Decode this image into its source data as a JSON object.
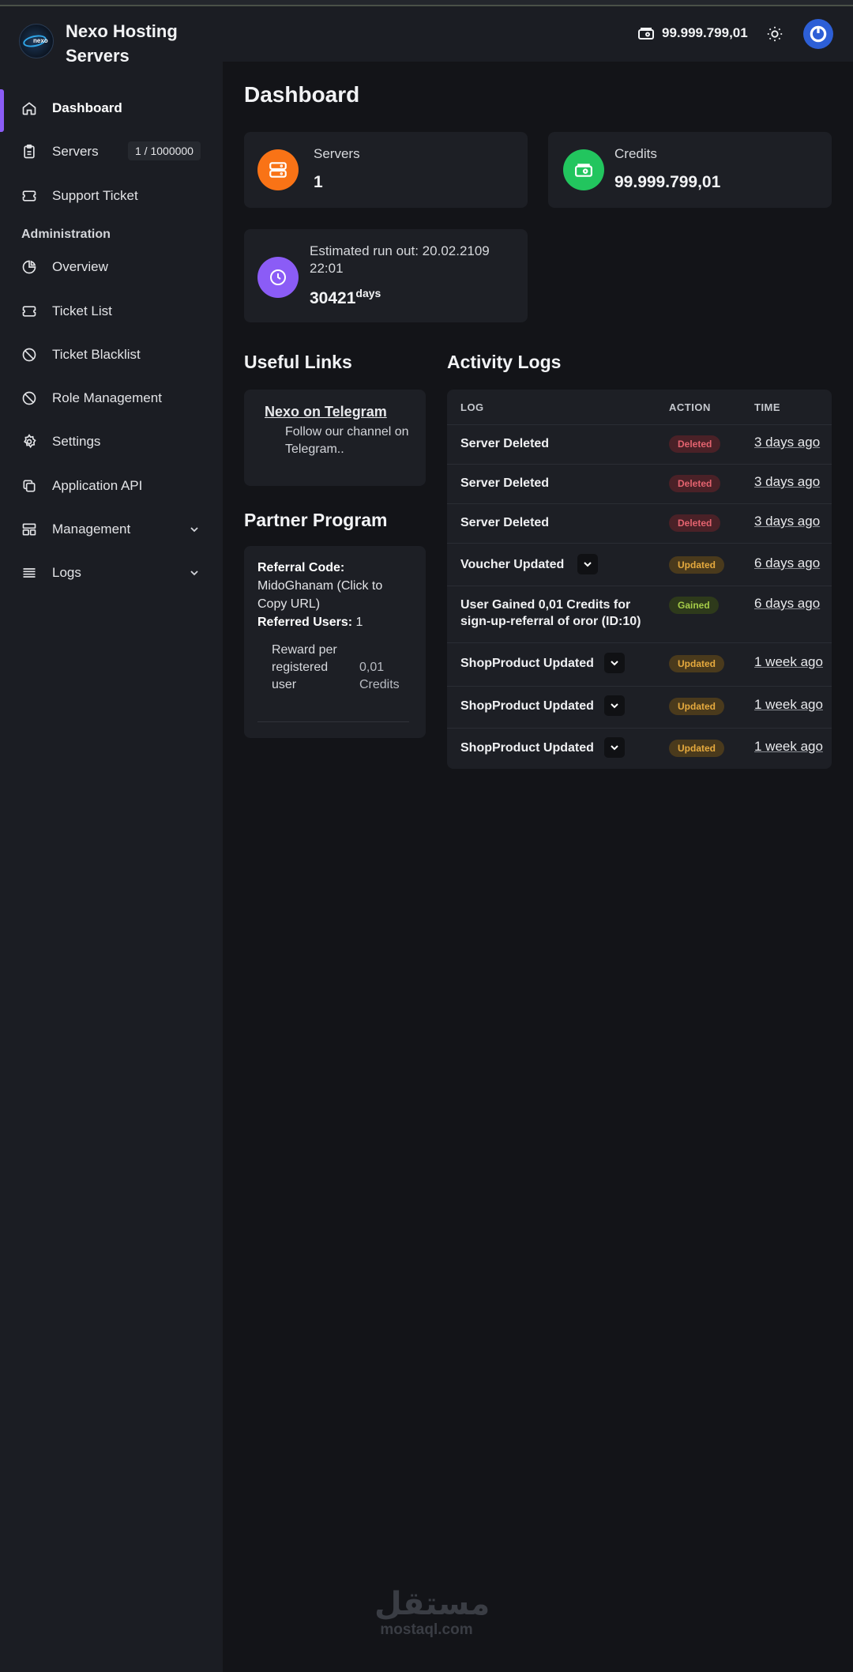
{
  "brand": {
    "name": "Nexo Hosting Servers",
    "logo_text": "nexo"
  },
  "header": {
    "credits": "99.999.799,01"
  },
  "sidebar": {
    "items": [
      {
        "label": "Dashboard",
        "icon": "home-icon"
      },
      {
        "label": "Servers",
        "badge": "1 / 1000000",
        "icon": "clipboard-icon"
      },
      {
        "label": "Support Ticket",
        "icon": "ticket-icon"
      },
      {
        "label": "Overview",
        "icon": "pie-chart-icon"
      },
      {
        "label": "Ticket List",
        "icon": "ticket-icon"
      },
      {
        "label": "Ticket Blacklist",
        "icon": "ban-icon"
      },
      {
        "label": "Role Management",
        "icon": "ban-icon"
      },
      {
        "label": "Settings",
        "icon": "gear-icon"
      },
      {
        "label": "Application API",
        "icon": "copy-icon"
      },
      {
        "label": "Management",
        "icon": "layout-icon"
      },
      {
        "label": "Logs",
        "icon": "list-icon"
      }
    ],
    "section_admin": "Administration"
  },
  "page": {
    "title": "Dashboard"
  },
  "stats": {
    "servers_label": "Servers",
    "servers_value": "1",
    "credits_label": "Credits",
    "credits_value": "99.999.799,01",
    "runout_label": "Estimated run out: 20.02.2109 22:01",
    "runout_value": "30421",
    "runout_unit": "days",
    "colors": {
      "servers": "#f97316",
      "credits": "#22c55e",
      "runout": "#8b5cf6"
    }
  },
  "useful_links": {
    "title": "Useful Links",
    "link_title": "Nexo on Telegram",
    "link_desc": "Follow our channel on Telegram.."
  },
  "partner": {
    "title": "Partner Program",
    "referral_code_label": "Referral Code:",
    "referral_code_value": "MidoGhanam (Click to Copy URL)",
    "referred_users_label": "Referred Users:",
    "referred_users_value": "1",
    "reward_label": "Reward per registered user",
    "reward_value": "0,01 Credits"
  },
  "activity": {
    "title": "Activity Logs",
    "columns": [
      "LOG",
      "ACTION",
      "TIME"
    ],
    "rows": [
      {
        "log": "Server Deleted",
        "action": "Deleted",
        "time": "3 days ago"
      },
      {
        "log": "Server Deleted",
        "action": "Deleted",
        "time": "3 days ago"
      },
      {
        "log": "Server Deleted",
        "action": "Deleted",
        "time": "3 days ago"
      },
      {
        "log": "Voucher Updated",
        "action": "Updated",
        "time": "6 days ago"
      },
      {
        "log": "User Gained 0,01 Credits for sign-up-referral of oror (ID:10)",
        "action": "Gained",
        "time": "6 days ago"
      },
      {
        "log": "ShopProduct Updated",
        "action": "Updated",
        "time": "1 week ago"
      },
      {
        "log": "ShopProduct Updated",
        "action": "Updated",
        "time": "1 week ago"
      },
      {
        "log": "ShopProduct Updated",
        "action": "Updated",
        "time": "1 week ago"
      }
    ]
  },
  "watermark": {
    "arabic": "مستقل",
    "latin": "mostaql.com"
  }
}
